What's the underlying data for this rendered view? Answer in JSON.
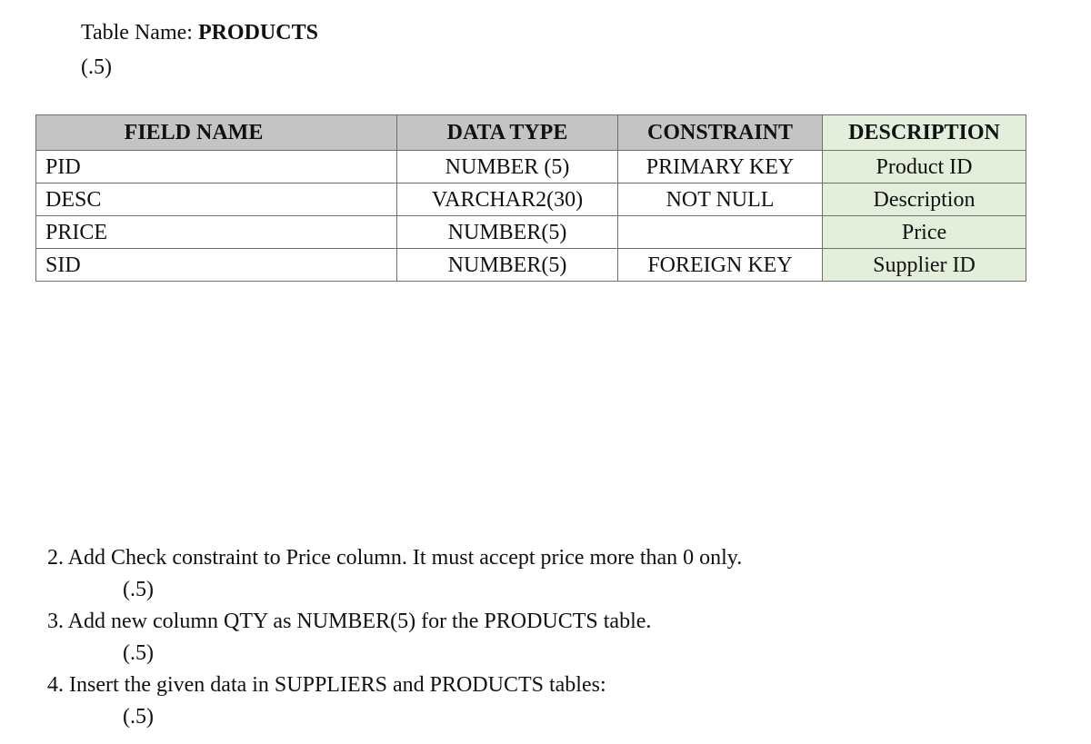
{
  "header": {
    "table_name_label": "Table Name: ",
    "table_name_value": "PRODUCTS",
    "points": "(.5)"
  },
  "schema_table": {
    "columns": [
      "FIELD NAME",
      "DATA TYPE",
      "CONSTRAINT",
      "DESCRIPTION"
    ],
    "rows": [
      {
        "field": "PID",
        "type": "NUMBER (5)",
        "constraint": "PRIMARY KEY",
        "description": "Product ID"
      },
      {
        "field": "DESC",
        "type": "VARCHAR2(30)",
        "constraint": "NOT NULL",
        "description": "Description"
      },
      {
        "field": "PRICE",
        "type": "NUMBER(5)",
        "constraint": "",
        "description": "Price"
      },
      {
        "field": "SID",
        "type": "NUMBER(5)",
        "constraint": "FOREIGN KEY",
        "description": "Supplier ID"
      }
    ],
    "colors": {
      "header_bg": "#c4c4c4",
      "description_bg": "#e3efda",
      "border": "#6e6e6e"
    }
  },
  "questions": [
    {
      "text": "2. Add Check constraint to Price column. It must accept price more than 0 only.",
      "points": "(.5)"
    },
    {
      "text": "3. Add new column QTY as NUMBER(5) for the PRODUCTS table.",
      "points": "(.5)"
    },
    {
      "text": "4. Insert the given data in SUPPLIERS and PRODUCTS tables:",
      "points": "(.5)"
    }
  ]
}
